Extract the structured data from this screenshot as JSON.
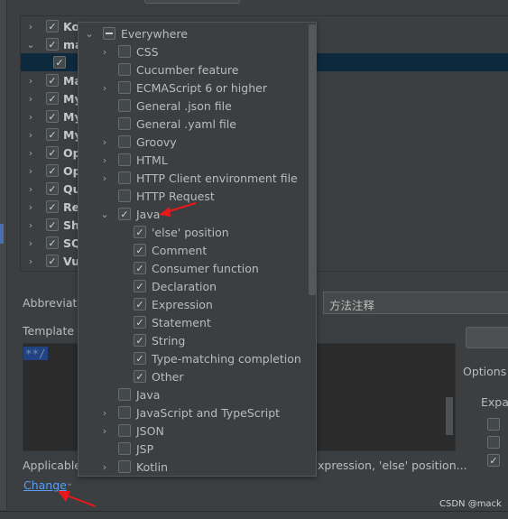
{
  "tree": {
    "rows": [
      {
        "label": "Kotl",
        "expanded": false,
        "checked": true
      },
      {
        "label": "ma",
        "expanded": true,
        "checked": true
      },
      {
        "label": "",
        "child": true,
        "checked": true,
        "selected": true
      },
      {
        "label": "Mat",
        "expanded": false,
        "checked": true
      },
      {
        "label": "My",
        "expanded": false,
        "checked": true
      },
      {
        "label": "My",
        "expanded": false,
        "checked": true
      },
      {
        "label": "My",
        "expanded": false,
        "checked": true
      },
      {
        "label": "Ope",
        "expanded": false,
        "checked": true
      },
      {
        "label": "Ope",
        "expanded": false,
        "checked": true
      },
      {
        "label": "Qui",
        "expanded": false,
        "checked": true
      },
      {
        "label": "Rea",
        "expanded": false,
        "checked": true
      },
      {
        "label": "She",
        "expanded": false,
        "checked": true
      },
      {
        "label": "SQL",
        "expanded": false,
        "checked": true
      },
      {
        "label": "Vue",
        "expanded": false,
        "checked": true
      }
    ]
  },
  "popup": {
    "items": [
      {
        "label": "Everywhere",
        "level": 0,
        "chevron": "down",
        "state": "partial"
      },
      {
        "label": "CSS",
        "level": 1,
        "chevron": "right",
        "state": "off"
      },
      {
        "label": "Cucumber feature",
        "level": 1,
        "chevron": "",
        "state": "off"
      },
      {
        "label": "ECMAScript 6 or higher",
        "level": 1,
        "chevron": "right",
        "state": "off"
      },
      {
        "label": "General .json file",
        "level": 1,
        "chevron": "",
        "state": "off"
      },
      {
        "label": "General .yaml file",
        "level": 1,
        "chevron": "",
        "state": "off"
      },
      {
        "label": "Groovy",
        "level": 1,
        "chevron": "right",
        "state": "off"
      },
      {
        "label": "HTML",
        "level": 1,
        "chevron": "right",
        "state": "off"
      },
      {
        "label": "HTTP Client environment file",
        "level": 1,
        "chevron": "right",
        "state": "off"
      },
      {
        "label": "HTTP Request",
        "level": 1,
        "chevron": "",
        "state": "off"
      },
      {
        "label": "Java",
        "level": 1,
        "chevron": "down",
        "state": "on"
      },
      {
        "label": "'else' position",
        "level": 2,
        "chevron": "",
        "state": "on"
      },
      {
        "label": "Comment",
        "level": 2,
        "chevron": "",
        "state": "on"
      },
      {
        "label": "Consumer function",
        "level": 2,
        "chevron": "",
        "state": "on"
      },
      {
        "label": "Declaration",
        "level": 2,
        "chevron": "",
        "state": "on"
      },
      {
        "label": "Expression",
        "level": 2,
        "chevron": "",
        "state": "on"
      },
      {
        "label": "Statement",
        "level": 2,
        "chevron": "",
        "state": "on"
      },
      {
        "label": "String",
        "level": 2,
        "chevron": "",
        "state": "on"
      },
      {
        "label": "Type-matching completion",
        "level": 2,
        "chevron": "",
        "state": "on"
      },
      {
        "label": "Other",
        "level": 2,
        "chevron": "",
        "state": "on"
      },
      {
        "label": "Java",
        "level": 1,
        "chevron": "",
        "state": "off"
      },
      {
        "label": "JavaScript and TypeScript",
        "level": 1,
        "chevron": "right",
        "state": "off"
      },
      {
        "label": "JSON",
        "level": 1,
        "chevron": "right",
        "state": "off"
      },
      {
        "label": "JSP",
        "level": 1,
        "chevron": "",
        "state": "off"
      },
      {
        "label": "Kotlin",
        "level": 1,
        "chevron": "right",
        "state": "off"
      }
    ]
  },
  "form": {
    "abbreviation_label": "Abbreviati",
    "template_label": "Template t",
    "description_value": "方法注释",
    "template_text": "**/",
    "applicable_label": "Applicable",
    "applicable_value": "xpression, 'else' position...",
    "change_link": "Change",
    "options_label": "Options",
    "expand_label": "Expar",
    "options_checks": [
      false,
      false,
      true
    ]
  },
  "watermark": "CSDN @mack",
  "colors": {
    "accent": "#589df6",
    "selection": "#0d293e",
    "annotation_arrow": "#e8191a"
  }
}
